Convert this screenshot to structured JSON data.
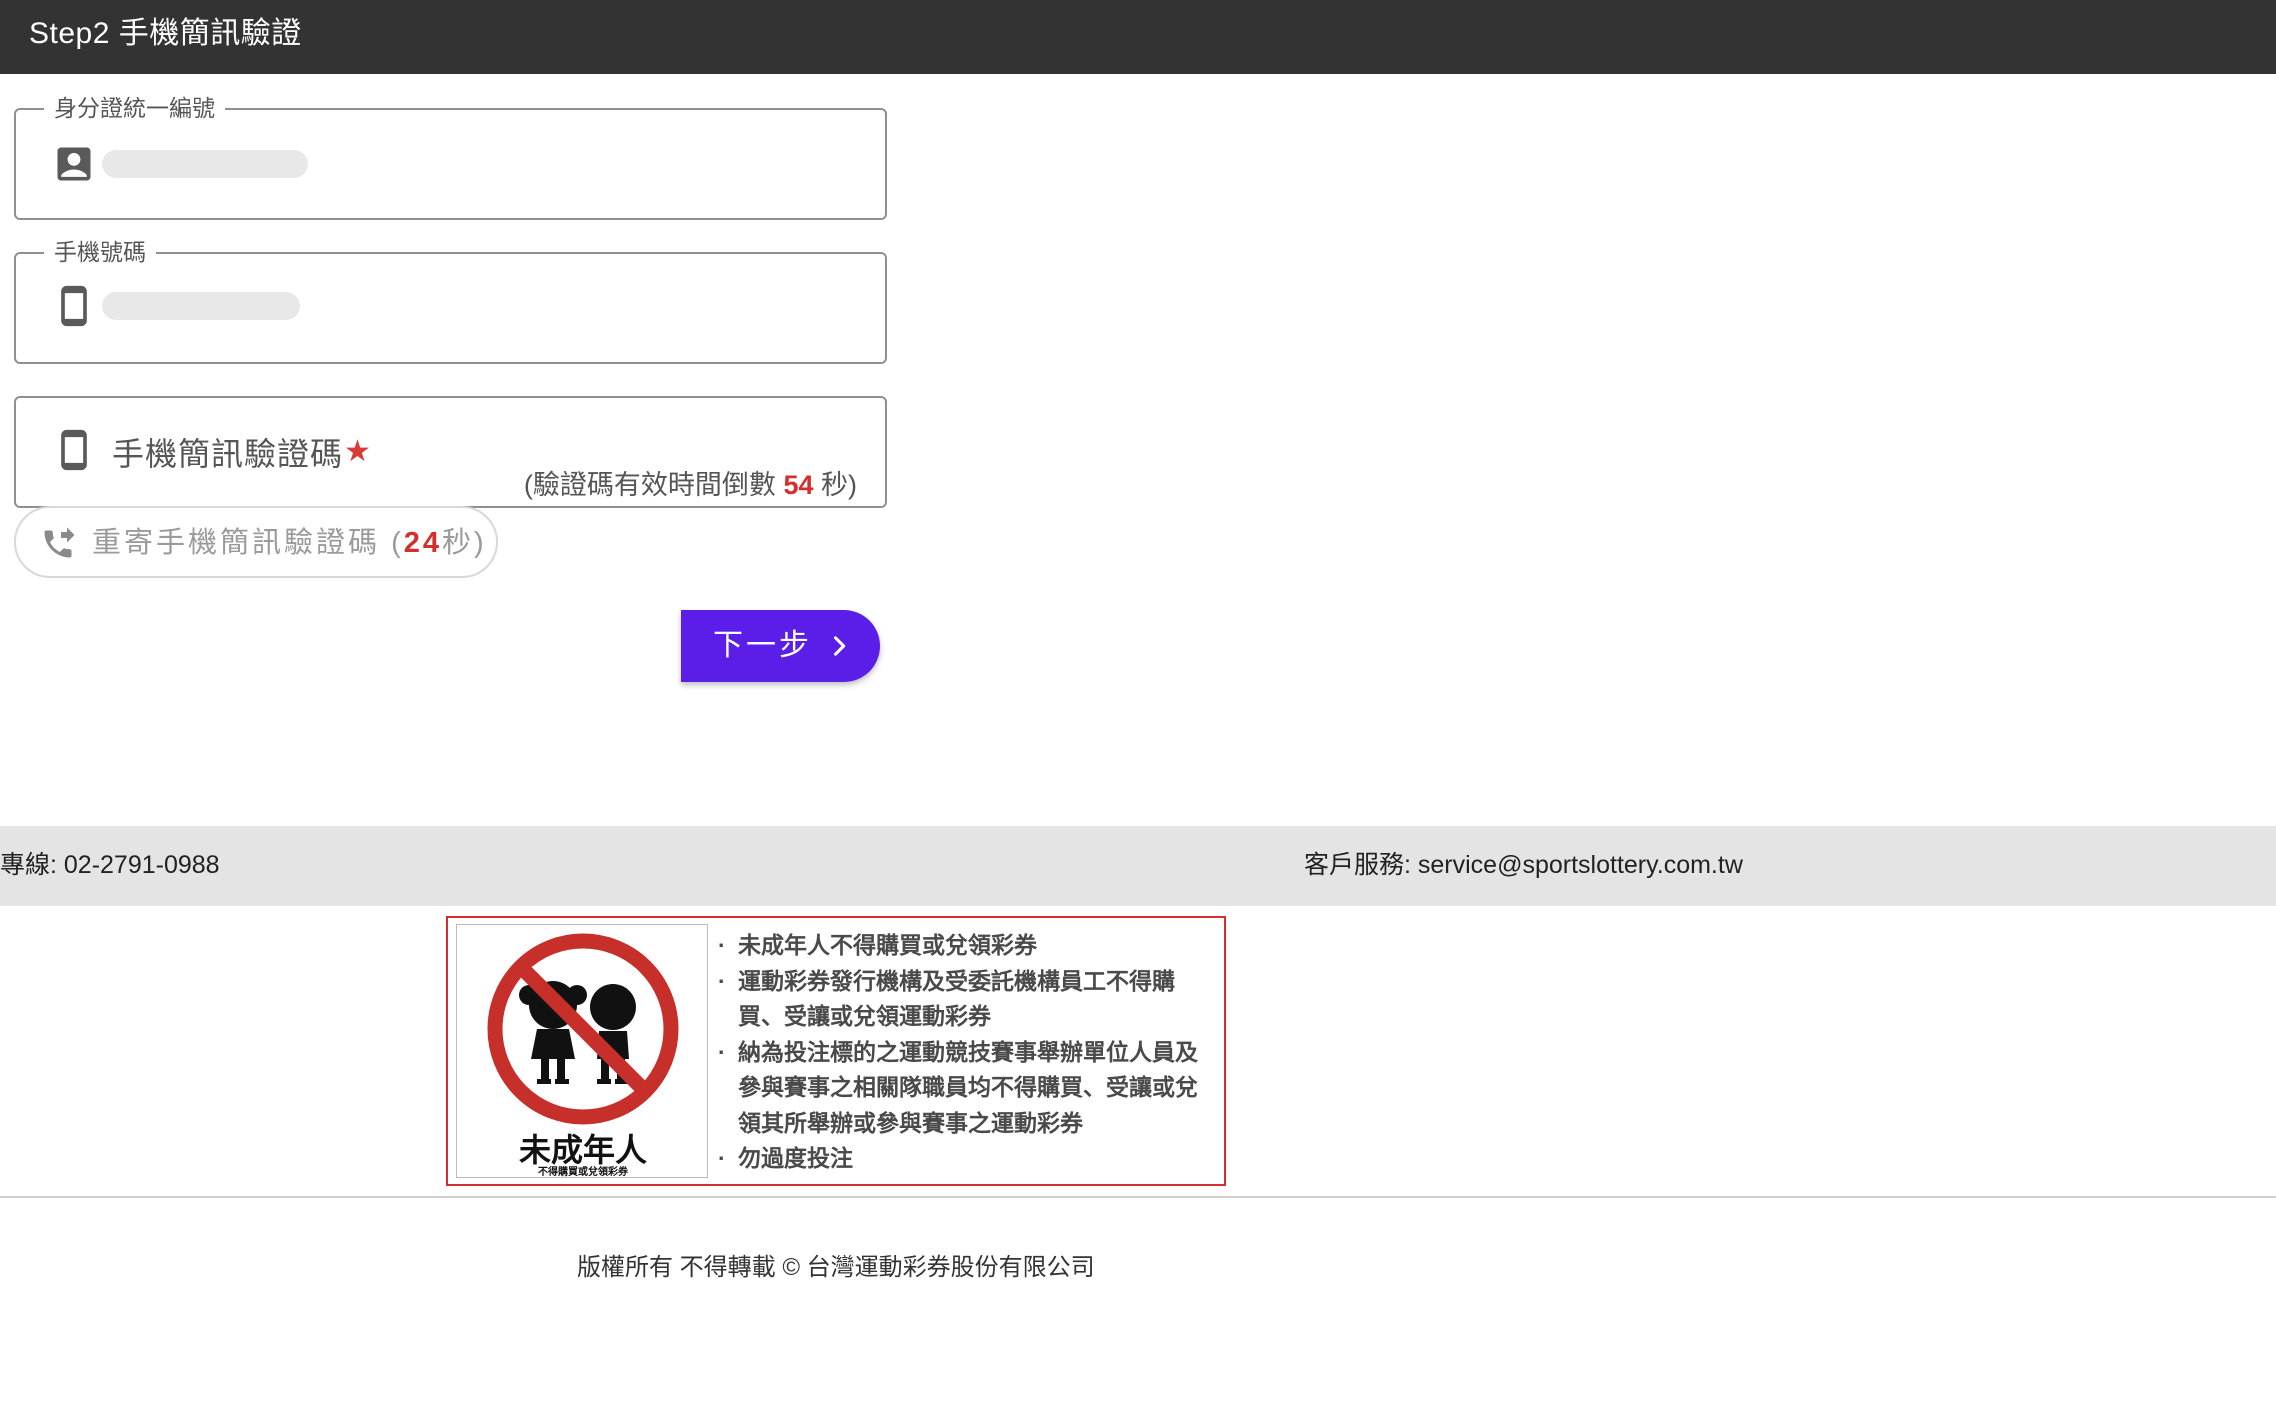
{
  "header": {
    "title": "Step2 手機簡訊驗證"
  },
  "form": {
    "id_field": {
      "label": "身分證統一編號",
      "icon": "contact-card-icon",
      "value_masked": true
    },
    "phone_field": {
      "label": "手機號碼",
      "icon": "smartphone-icon",
      "value_masked": true
    },
    "code_field": {
      "placeholder": "手機簡訊驗證碼",
      "required_mark": "★",
      "icon": "smartphone-icon",
      "countdown_prefix": "(驗證碼有效時間倒數",
      "countdown_seconds": "54",
      "countdown_suffix": "秒)"
    },
    "resend": {
      "label": "重寄手機簡訊驗證碼",
      "open_paren": "(",
      "seconds": "24",
      "unit": "秒",
      "close_paren": ")",
      "icon": "phone-forward-icon"
    },
    "next_button": {
      "label": "下一步",
      "icon": "chevron-right-icon"
    }
  },
  "contact": {
    "hotline": "專線: 02-2791-0988",
    "service": "客戶服務: service@sportslottery.com.tw"
  },
  "notice": {
    "image_title": "未成年人",
    "image_subtitle": "不得購買或兌領彩券",
    "rules": [
      "未成年人不得購買或兌領彩券",
      "運動彩券發行機構及受委託機構員工不得購買、受讓或兌領運動彩券",
      "納為投注標的之運動競技賽事舉辦單位人員及參與賽事之相關隊職員均不得購買、受讓或兌領其所舉辦或參與賽事之運動彩券",
      "勿過度投注"
    ],
    "border_color": "#d32f2f"
  },
  "footer": {
    "copyright": "版權所有 不得轉載 © 台灣運動彩券股份有限公司"
  },
  "colors": {
    "header_bg": "#333333",
    "accent": "#5b1ee8",
    "countdown": "#d32f2f",
    "contact_bg": "#e4e4e4"
  }
}
